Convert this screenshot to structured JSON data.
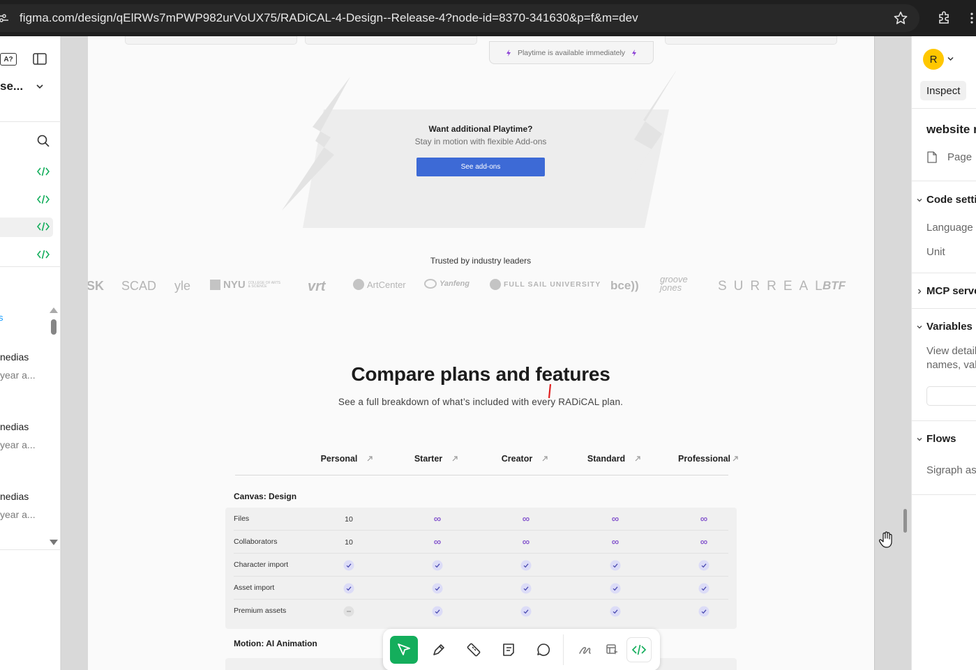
{
  "browser": {
    "url": "figma.com/design/qElRWs7mPWP982urVoUX75/RADiCAL-4-Design--Release-4?node-id=8370-341630&p=f&m=dev"
  },
  "left_panel": {
    "file_title": "se...",
    "files": [
      {
        "name": "nedias",
        "time": "year a..."
      },
      {
        "name": "nedias",
        "time": "year a..."
      },
      {
        "name": "nedias",
        "time": "year a..."
      }
    ],
    "blue_link": "s"
  },
  "design": {
    "playtime_note": "Playtime is available immediately",
    "addon_title": "Want additional Playtime?",
    "addon_subtitle": "Stay in motion with flexible Add-ons",
    "addon_button": "See add-ons",
    "trusted_label": "Trusted by industry leaders",
    "logos": [
      "SK",
      "SCAD",
      "yle",
      "NYU",
      "COLLEGE OF ARTS & SCIENCE",
      "vrt",
      "ArtCenter",
      "Yanfeng",
      "FULL SAIL UNIVERSITY",
      "bce))",
      "groove jones",
      "SURREAL",
      "BTF"
    ],
    "compare_title": "Compare plans and features",
    "compare_subtitle": "See a full breakdown of what’s included with every RADiCAL plan.",
    "plans": [
      "Personal",
      "Starter",
      "Creator",
      "Standard",
      "Professional"
    ],
    "section1": "Canvas: Design",
    "rows": [
      {
        "label": "Files",
        "values": [
          "10",
          "∞",
          "∞",
          "∞",
          "∞"
        ]
      },
      {
        "label": "Collaborators",
        "values": [
          "10",
          "∞",
          "∞",
          "∞",
          "∞"
        ]
      },
      {
        "label": "Character import",
        "values": [
          "check",
          "check",
          "check",
          "check",
          "check"
        ]
      },
      {
        "label": "Asset import",
        "values": [
          "check",
          "check",
          "check",
          "check",
          "check"
        ]
      },
      {
        "label": "Premium assets",
        "values": [
          "dash",
          "check",
          "check",
          "check",
          "check"
        ]
      }
    ],
    "section2": "Motion: AI Animation"
  },
  "toolbar": {
    "tools": [
      "move-tool",
      "pen-tool",
      "ruler-tool",
      "annotate-tool",
      "comment-tool",
      "draw-tool",
      "inspect-tool",
      "dev-mode-tool"
    ]
  },
  "right_panel": {
    "avatar_letter": "R",
    "inspect_tab": "Inspect",
    "selection_title": "website n",
    "page_label": "Page",
    "code_settings": "Code settin",
    "language": "Language",
    "unit": "Unit",
    "mcp": "MCP serve",
    "variables": "Variables",
    "variables_desc_1": "View detail",
    "variables_desc_2": "names, valu",
    "flows": "Flows",
    "flows_item": "Sigraph asi"
  },
  "colors": {
    "accent_green": "#14ae5c",
    "button_blue": "#3d6ad6",
    "infinity_purple": "#8b5fcf",
    "avatar_yellow": "#ffc700"
  }
}
